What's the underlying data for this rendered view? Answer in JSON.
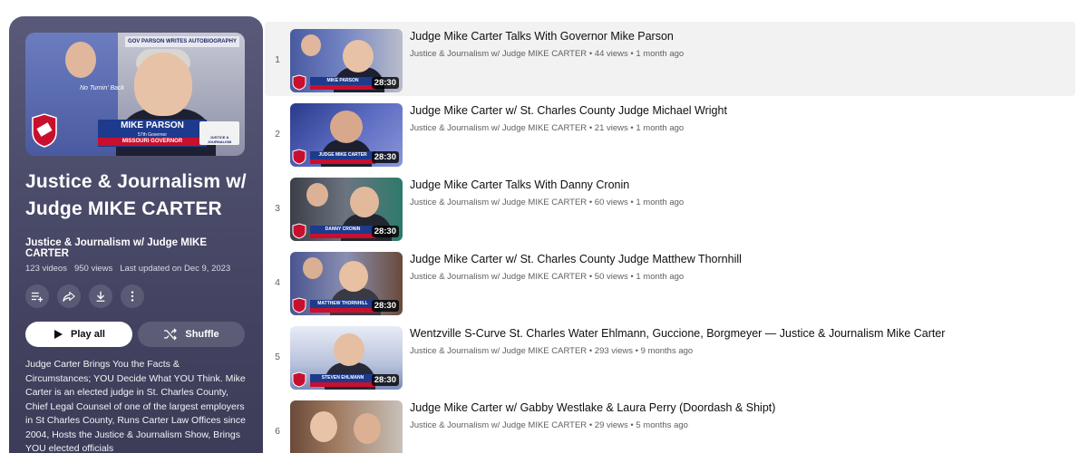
{
  "playlist": {
    "title": "Justice & Journalism w/ Judge MIKE CARTER",
    "owner": "Justice & Journalism w/ Judge MIKE CARTER",
    "video_count": "123 videos",
    "views": "950 views",
    "updated": "Last updated on Dec 9, 2023",
    "play_all_label": "Play all",
    "shuffle_label": "Shuffle",
    "description": "Judge Carter Brings You the Facts & Circumstances; YOU Decide What YOU Think. Mike Carter is an elected judge in St. Charles County, Chief Legal Counsel of one of the largest employers in St Charles County, Runs Carter Law Offices since 2004, Hosts the Justice & Journalism Show, Brings YOU elected officials",
    "hero": {
      "banner_top": "GOV PARSON WRITES AUTOBIOGRAPHY",
      "tagline": "No Turnin' Back",
      "name": "MIKE PARSON",
      "subtitle": "57th Governor",
      "role": "MISSOURI GOVERNOR",
      "brand": "JUSTICE & JOURNALISM"
    }
  },
  "videos": [
    {
      "index": "1",
      "title": "Judge Mike Carter Talks With Governor Mike Parson",
      "channel": "Justice & Journalism w/ Judge MIKE CARTER",
      "views": "44 views",
      "age": "1 month ago",
      "duration": "28:30",
      "strip": "MIKE PARSON"
    },
    {
      "index": "2",
      "title": "Judge Mike Carter w/ St. Charles County Judge Michael Wright",
      "channel": "Justice & Journalism w/ Judge MIKE CARTER",
      "views": "21 views",
      "age": "1 month ago",
      "duration": "28:30",
      "strip": "JUDGE MIKE CARTER"
    },
    {
      "index": "3",
      "title": "Judge Mike Carter Talks With Danny Cronin",
      "channel": "Justice & Journalism w/ Judge MIKE CARTER",
      "views": "60 views",
      "age": "1 month ago",
      "duration": "28:30",
      "strip": "DANNY CRONIN"
    },
    {
      "index": "4",
      "title": "Judge Mike Carter w/ St. Charles County Judge Matthew Thornhill",
      "channel": "Justice & Journalism w/ Judge MIKE CARTER",
      "views": "50 views",
      "age": "1 month ago",
      "duration": "28:30",
      "strip": "MATTHEW THORNHILL"
    },
    {
      "index": "5",
      "title": "Wentzville S-Curve St. Charles Water Ehlmann, Guccione, Borgmeyer — Justice & Journalism Mike Carter",
      "channel": "Justice & Journalism w/ Judge MIKE CARTER",
      "views": "293 views",
      "age": "9 months ago",
      "duration": "28:30",
      "strip": "STEVEN EHLMANN"
    },
    {
      "index": "6",
      "title": "Judge Mike Carter w/ Gabby Westlake & Laura Perry (Doordash & Shipt)",
      "channel": "Justice & Journalism w/ Judge MIKE CARTER",
      "views": "29 views",
      "age": "5 months ago",
      "duration": "",
      "strip": ""
    }
  ],
  "colors": {
    "panel": "#4c4c6b",
    "strip_blue": "#1e3a8c",
    "strip_red": "#c8102e"
  }
}
